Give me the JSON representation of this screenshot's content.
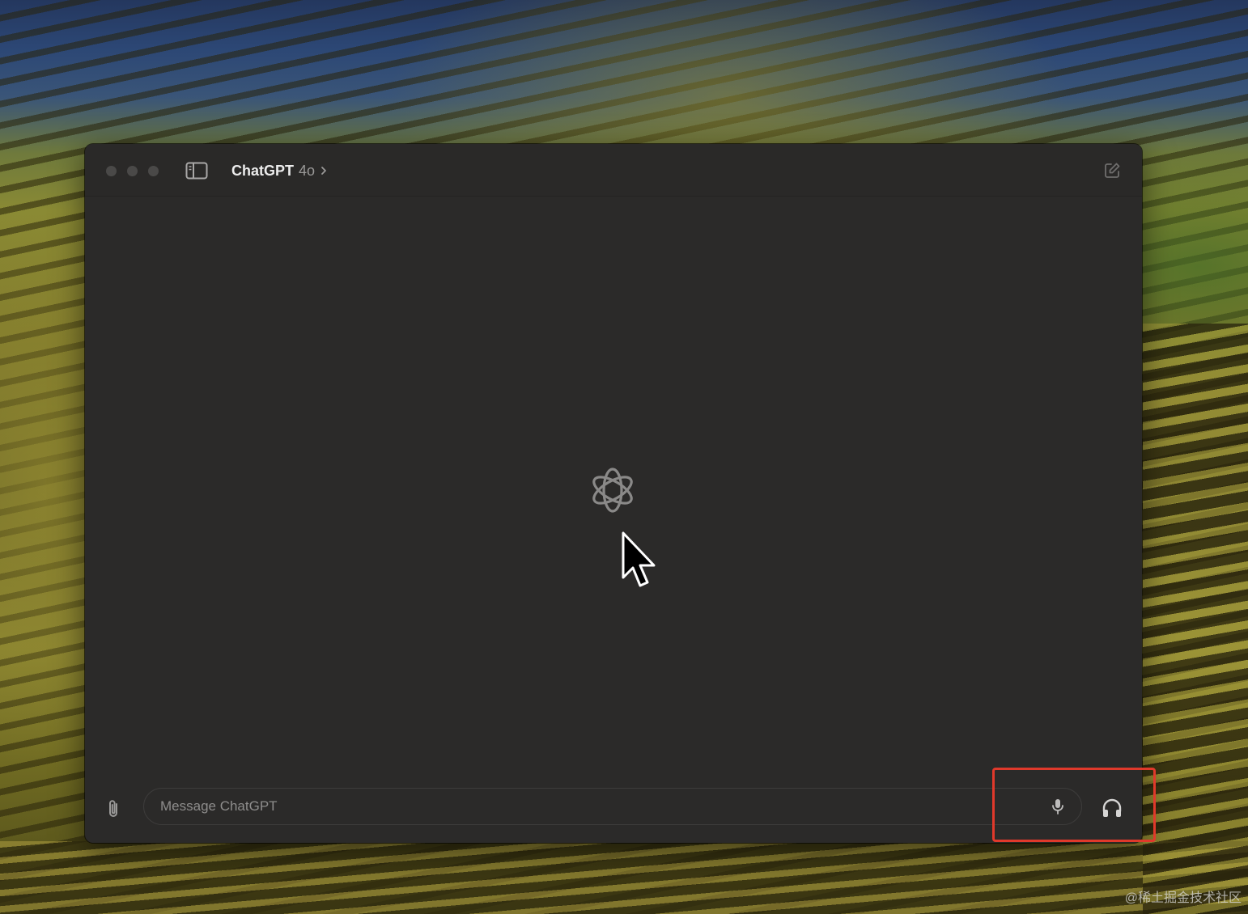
{
  "window": {
    "model_name": "ChatGPT",
    "model_version": "4o",
    "traffic_lights": [
      "close",
      "minimize",
      "zoom"
    ]
  },
  "icons": {
    "sidebar_toggle": "sidebar-icon",
    "title_chevron": "chevron-right-icon",
    "new_chat": "new-chat-icon",
    "center_logo": "openai-logo-icon",
    "attach": "paperclip-icon",
    "mic": "microphone-icon",
    "voice_mode": "headphones-icon",
    "cursor": "mouse-pointer-icon"
  },
  "composer": {
    "placeholder": "Message ChatGPT",
    "value": ""
  },
  "annotation": {
    "highlight_color": "#e0392b"
  },
  "watermark": "@稀土掘金技术社区",
  "colors": {
    "window_bg": "#2b2a29",
    "titlebar_bg": "#2a2928",
    "text_primary": "#ececec",
    "text_secondary": "#9a9998"
  }
}
